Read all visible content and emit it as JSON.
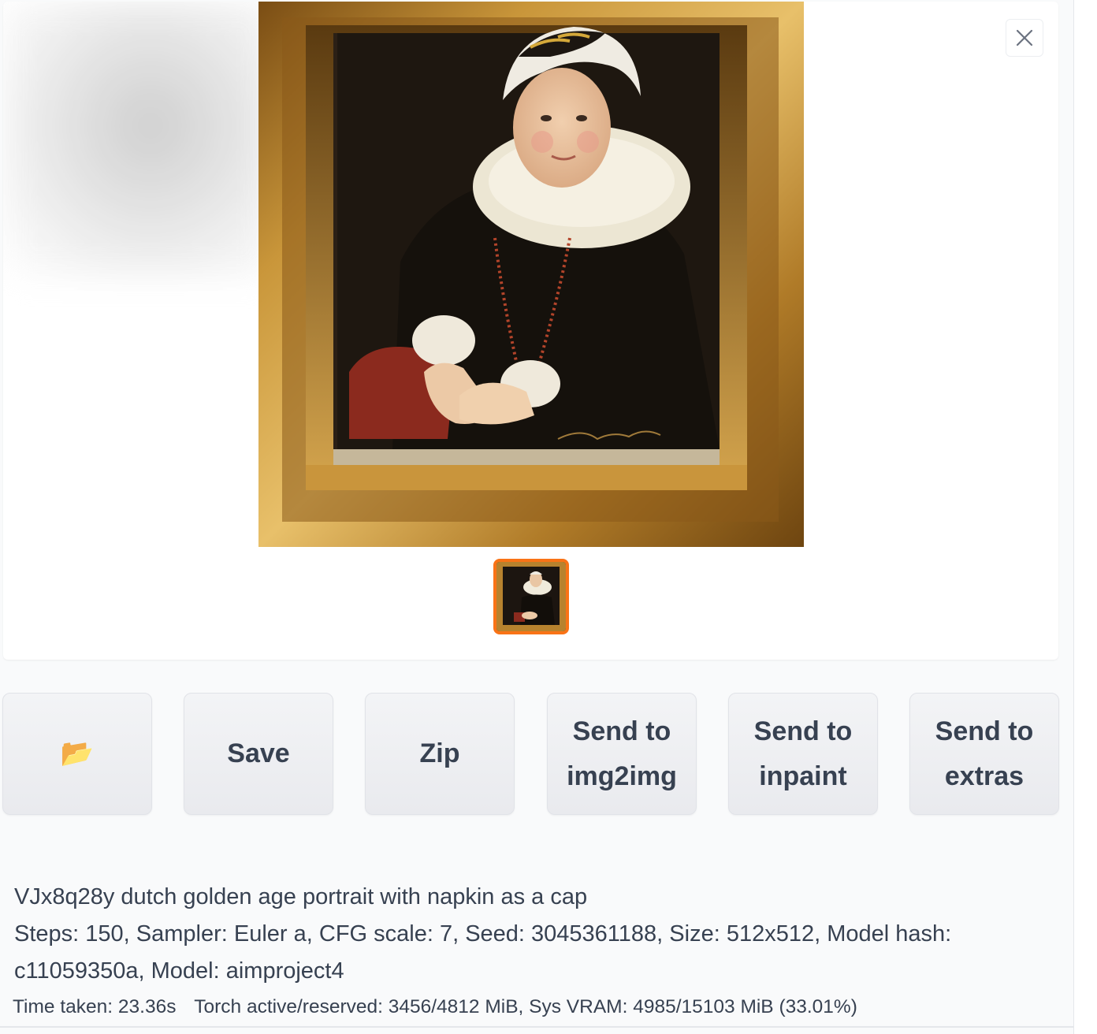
{
  "gallery": {
    "close_icon": "close-icon",
    "main_image_alt": "dutch golden age portrait painting in a gilded frame",
    "thumbnail_selected_color": "#f97316"
  },
  "actions": {
    "folder_icon": "folder-icon",
    "folder_glyph": "📂",
    "save_label": "Save",
    "zip_label": "Zip",
    "img2img_label": "Send to\nimg2img",
    "inpaint_label": "Send to\ninpaint",
    "extras_label": "Send to\nextras"
  },
  "generation_info": {
    "prompt": "VJx8q28y dutch golden age portrait with napkin as a cap",
    "params": "Steps: 150, Sampler: Euler a, CFG scale: 7, Seed: 3045361188, Size: 512x512, Model hash: c11059350a, Model: aimproject4"
  },
  "timing": {
    "time_taken": "Time taken: 23.36s",
    "memory": "Torch active/reserved: 3456/4812 MiB, Sys VRAM: 4985/15103 MiB (33.01%)"
  }
}
